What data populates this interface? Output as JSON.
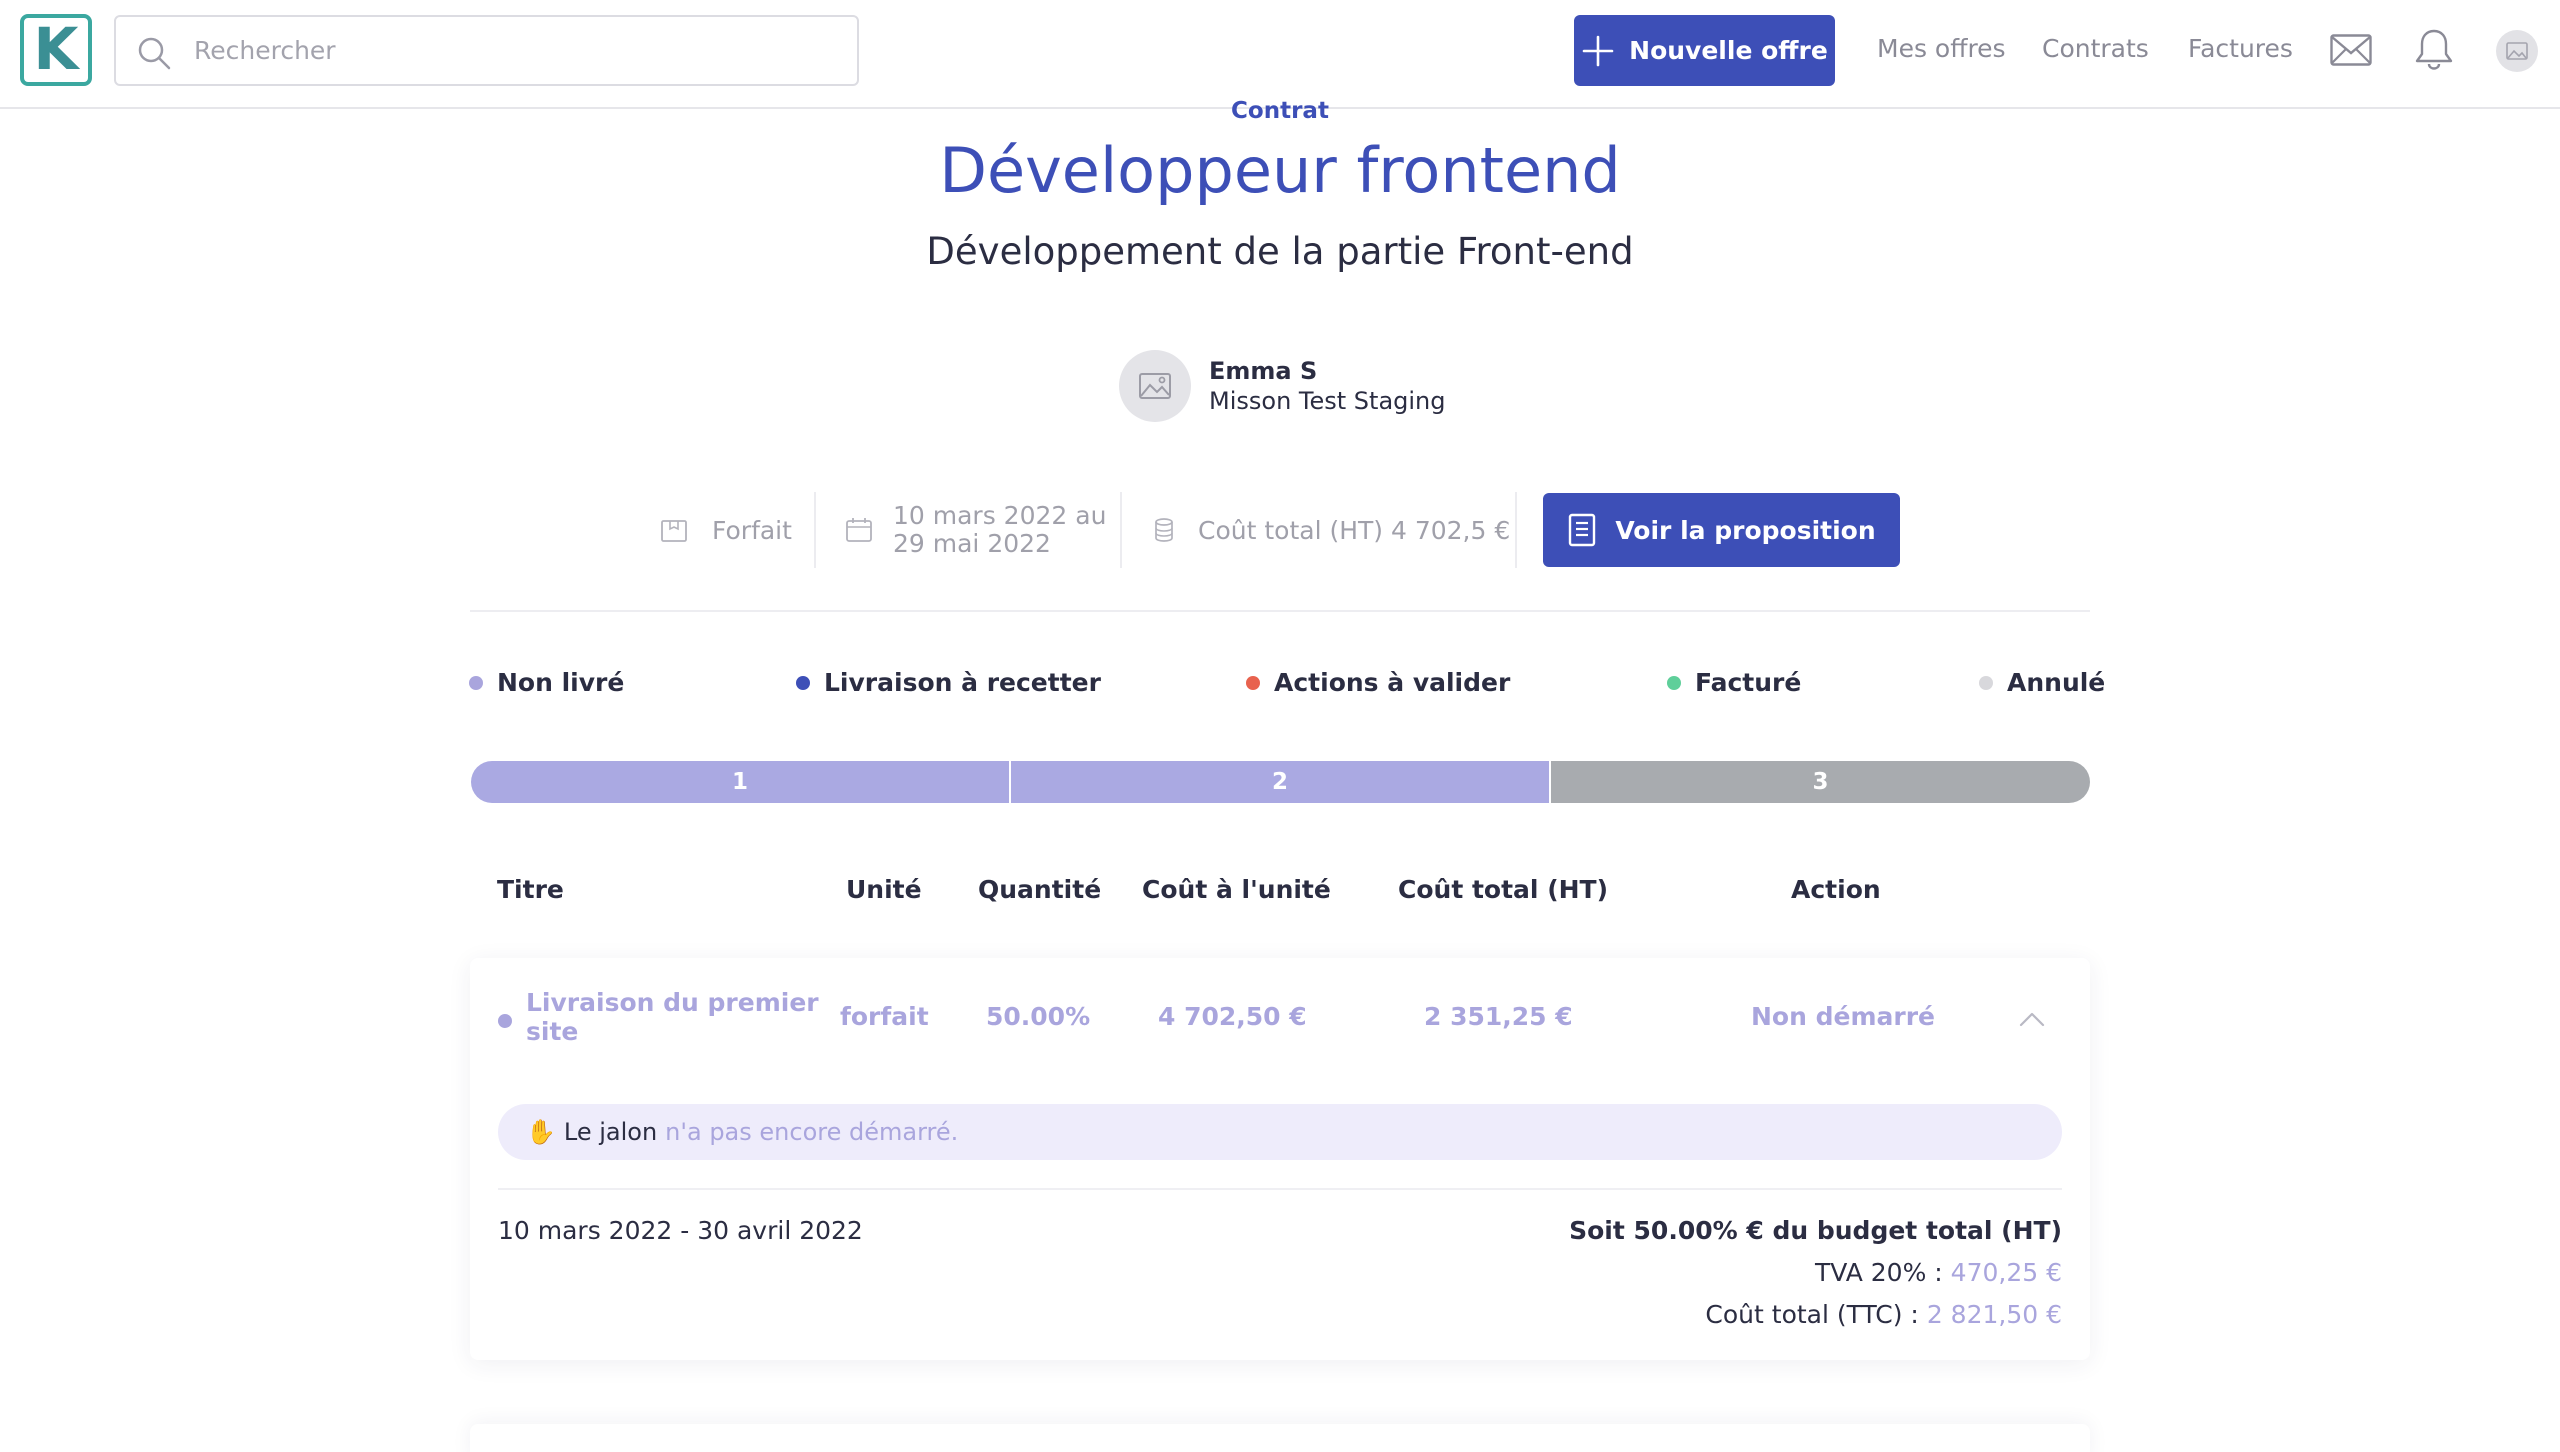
{
  "topbar": {
    "logo_letter": "K",
    "search": {
      "placeholder": "Rechercher",
      "value": ""
    },
    "new_offer_label": "Nouvelle offre",
    "nav": [
      "Mes offres",
      "Contrats",
      "Factures"
    ],
    "icons": [
      "search-icon",
      "plus-icon",
      "mail-icon",
      "bell-icon",
      "user-avatar-icon"
    ]
  },
  "header": {
    "eyebrow": "Contrat",
    "title": "Développeur frontend",
    "subtitle": "Développement de la partie Front-end"
  },
  "person": {
    "name": "Emma S",
    "mission": "Misson Test Staging"
  },
  "meta": {
    "type": "Forfait",
    "date_line1": "10 mars 2022 au",
    "date_line2": "29 mai 2022",
    "cost": "Coût total (HT) 4 702,5 €",
    "view_button": "Voir la proposition"
  },
  "legend": [
    {
      "label": "Non livré",
      "color": "#a9a5dd"
    },
    {
      "label": "Livraison à recetter",
      "color": "#3d4fb7"
    },
    {
      "label": "Actions à valider",
      "color": "#e8624e"
    },
    {
      "label": "Facturé",
      "color": "#5fcf9a"
    },
    {
      "label": "Annulé",
      "color": "#d8d8dc"
    }
  ],
  "progress": [
    {
      "label": "1",
      "color": "#aaa9e2"
    },
    {
      "label": "2",
      "color": "#aaa9e2"
    },
    {
      "label": "3",
      "color": "#a8abaf"
    }
  ],
  "table": {
    "headers": [
      "Titre",
      "Unité",
      "Quantité",
      "Coût à l'unité",
      "Coût total (HT)",
      "Action"
    ],
    "row": {
      "title_line1": "Livraison du premier",
      "title_line2": "site",
      "unit": "forfait",
      "quantity": "50.00%",
      "unit_cost": "4 702,50 €",
      "total_cost": "2 351,25 €",
      "action": "Non démarré",
      "notice_prefix": "Le jalon",
      "notice_highlight": "n'a pas encore démarré.",
      "dates": "10 mars 2022 - 30 avril 2022",
      "budget": "Soit 50.00% € du budget total (HT)",
      "tva_label": "TVA 20% :",
      "tva_value": "470,25 €",
      "ttc_label": "Coût total (TTC) :",
      "ttc_value": "2 821,50 €"
    }
  },
  "colors": {
    "primary": "#3d4fb7",
    "muted_violet": "#a9a5dd",
    "notice_bg": "#eeecfb"
  }
}
